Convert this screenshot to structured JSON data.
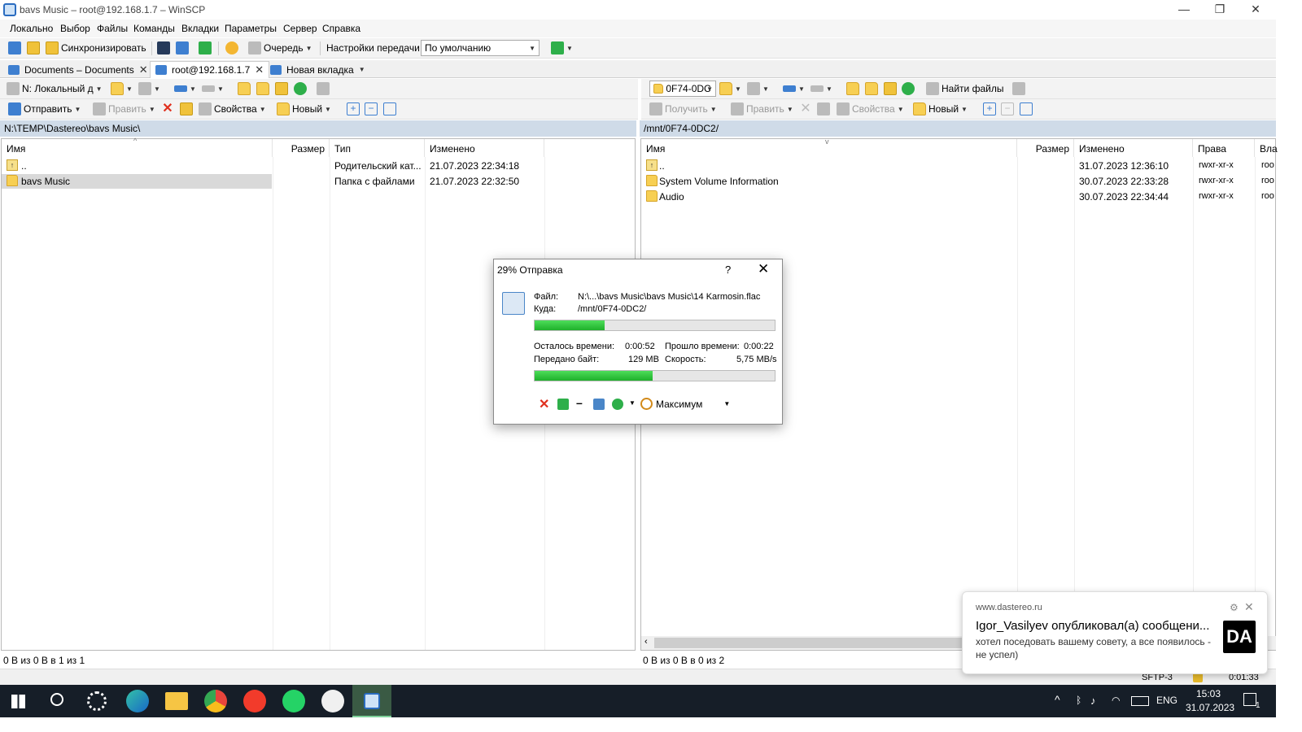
{
  "window": {
    "title": "bavs Music – root@192.168.1.7 – WinSCP",
    "min": "—",
    "restore": "❐",
    "close": "✕"
  },
  "menu": [
    "Локально",
    "Выбор",
    "Файлы",
    "Команды",
    "Вкладки",
    "Параметры",
    "Сервер",
    "Справка"
  ],
  "toolbar1": {
    "sync_label": "Синхронизировать",
    "queue_label": "Очередь",
    "transfer_settings_label": "Настройки передачи",
    "transfer_preset": "По умолчанию"
  },
  "tabs": [
    {
      "label": "Documents – Documents",
      "close": "✕"
    },
    {
      "label": "root@192.168.1.7",
      "close": "✕"
    },
    {
      "label": "Новая вкладка"
    }
  ],
  "left": {
    "drive": "N: Локальный д",
    "send_label": "Отправить",
    "edit_label": "Править",
    "props_label": "Свойства",
    "new_label": "Новый",
    "path": "N:\\TEMP\\Dastereo\\bavs Music\\",
    "columns": [
      "Имя",
      "Размер",
      "Тип",
      "Изменено"
    ],
    "rows": [
      {
        "name": "..",
        "size": "",
        "type": "Родительский кат...",
        "modified": "21.07.2023 22:34:18"
      },
      {
        "name": "bavs Music",
        "size": "",
        "type": "Папка с файлами",
        "modified": "21.07.2023 22:32:50"
      }
    ],
    "status": "0 B из 0 B в 1 из 1"
  },
  "right": {
    "drive": "0F74-0DC",
    "find_label": "Найти файлы",
    "get_label": "Получить",
    "edit_label": "Править",
    "props_label": "Свойства",
    "new_label": "Новый",
    "path": "/mnt/0F74-0DC2/",
    "columns": [
      "Имя",
      "Размер",
      "Изменено",
      "Права",
      "Вла"
    ],
    "rows": [
      {
        "name": "..",
        "size": "",
        "modified": "31.07.2023 12:36:10",
        "rights": "rwxr-xr-x",
        "owner": "roo"
      },
      {
        "name": "System Volume Information",
        "size": "",
        "modified": "30.07.2023 22:33:28",
        "rights": "rwxr-xr-x",
        "owner": "roo"
      },
      {
        "name": "Audio",
        "size": "",
        "modified": "30.07.2023 22:34:44",
        "rights": "rwxr-xr-x",
        "owner": "roo"
      }
    ],
    "status": "0 B из 0 B в 0 из 2"
  },
  "statusbar_right": {
    "protocol": "SFTP-3",
    "elapsed": "0:01:33"
  },
  "dialog": {
    "title": "29% Отправка",
    "help": "?",
    "close": "✕",
    "file_label": "Файл:",
    "file_value": "N:\\...\\bavs Music\\bavs Music\\14 Karmosin.flac",
    "target_label": "Куда:",
    "target_value": "/mnt/0F74-0DC2/",
    "file_progress": 0.29,
    "time_left_label": "Осталось времени:",
    "time_left": "0:00:52",
    "time_elapsed_label": "Прошло времени:",
    "time_elapsed": "0:00:22",
    "bytes_label": "Передано байт:",
    "bytes": "129 MB",
    "speed_label": "Скорость:",
    "speed": "5,75 MB/s",
    "total_progress": 0.49,
    "speed_limit": "Максимум"
  },
  "notification": {
    "source": "www.dastereo.ru",
    "headline": "Igor_Vasilyev опубликовал(а) сообщени...",
    "body": "хотел поседовать вашему совету, а все появилось - не успел)",
    "badge": "DA"
  },
  "taskbar": {
    "lang": "ENG",
    "time": "15:03",
    "date": "31.07.2023",
    "notif_count": "1"
  }
}
